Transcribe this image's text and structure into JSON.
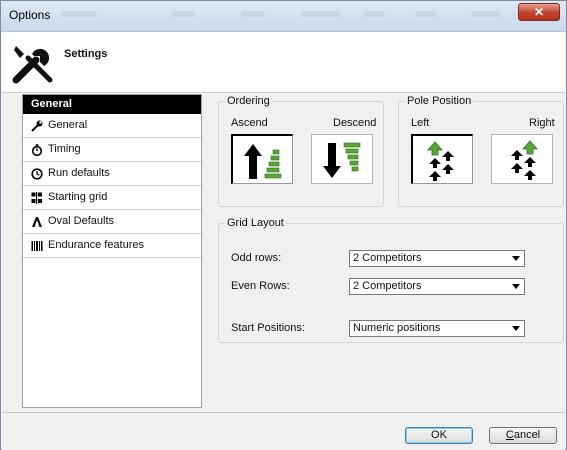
{
  "window": {
    "title": "Options",
    "close_glyph": "✕"
  },
  "header": {
    "title": "Settings",
    "icon": "wrench-screwdriver-icon"
  },
  "sidebar": {
    "heading": "General",
    "items": [
      {
        "label": "General",
        "icon": "wrench-icon"
      },
      {
        "label": "Timing",
        "icon": "stopwatch-icon"
      },
      {
        "label": "Run defaults",
        "icon": "clock-icon"
      },
      {
        "label": "Starting grid",
        "icon": "grid-icon"
      },
      {
        "label": "Oval Defaults",
        "icon": "oval-track-icon"
      },
      {
        "label": "Endurance features",
        "icon": "barcode-icon"
      }
    ]
  },
  "ordering": {
    "label": "Ordering",
    "ascend": "Ascend",
    "descend": "Descend",
    "selected": "Ascend"
  },
  "pole_position": {
    "label": "Pole Position",
    "left": "Left",
    "right": "Right",
    "selected": "Left"
  },
  "grid_layout": {
    "label": "Grid Layout",
    "odd_rows": {
      "label": "Odd rows:",
      "value": "2 Competitors"
    },
    "even_rows": {
      "label": "Even Rows:",
      "value": "2 Competitors"
    },
    "start_positions": {
      "label": "Start Positions:",
      "value": "Numeric positions"
    }
  },
  "footer": {
    "ok": "OK",
    "cancel": "Cancel"
  },
  "colors": {
    "accent_green": "#5aa63a",
    "header_black": "#000000"
  }
}
